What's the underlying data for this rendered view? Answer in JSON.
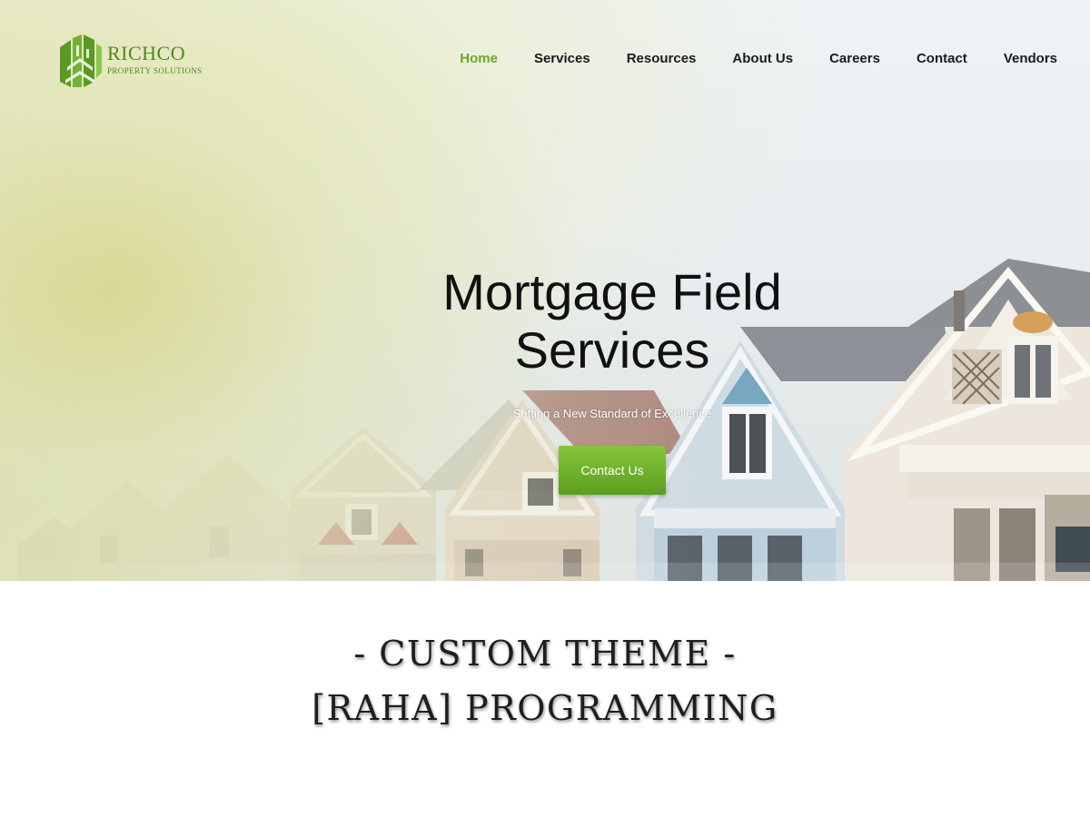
{
  "brand": {
    "name": "RICHCO",
    "tagline": "PROPERTY SOLUTIONS",
    "color": "#4f8a1e"
  },
  "nav": {
    "items": [
      {
        "label": "Home",
        "active": true
      },
      {
        "label": "Services",
        "active": false
      },
      {
        "label": "Resources",
        "active": false
      },
      {
        "label": "About Us",
        "active": false
      },
      {
        "label": "Careers",
        "active": false
      },
      {
        "label": "Contact",
        "active": false
      },
      {
        "label": "Vendors",
        "active": false
      }
    ],
    "active_color": "#6fa52b"
  },
  "hero": {
    "title_line1": "Mortgage Field",
    "title_line2": "Services",
    "subtitle": "Setting a New Standard of Excellence",
    "cta_label": "Contact Us",
    "cta_color": "#6fb02a",
    "background_icon": "victorian-houses-image"
  },
  "caption": {
    "line1": "- CUSTOM THEME -",
    "line2": "[RAHA] PROGRAMMING"
  }
}
